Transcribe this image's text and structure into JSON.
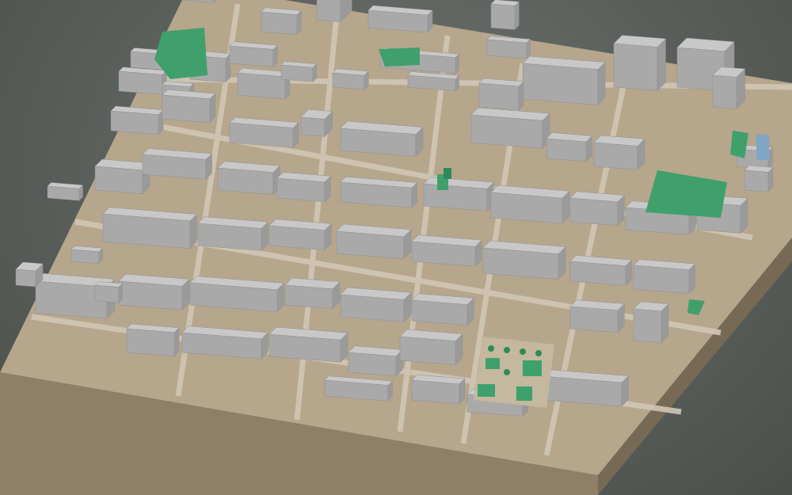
{
  "scene": {
    "subject": "3d-city-block-model",
    "colors": {
      "background": "#5d625e",
      "base_top": "#b6a68c",
      "base_front": "#8e7f66",
      "base_side": "#786b56",
      "building_top": "#c8c8c8",
      "building_side": "#a9a9a9",
      "building_shadow": "#9a9a9a",
      "park": "#3fa06c",
      "park_dark": "#2f8a59",
      "water": "#7fa6c4"
    }
  }
}
